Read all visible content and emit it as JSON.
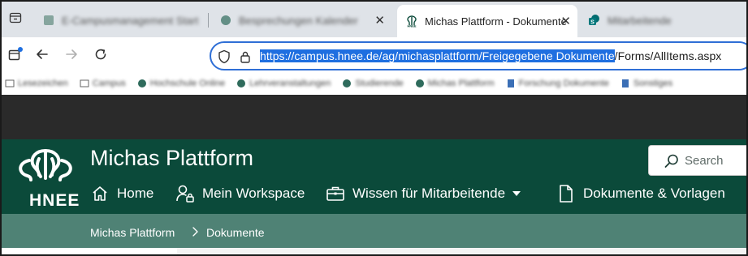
{
  "browser": {
    "tabs": [
      {
        "title": "E-Campusmanagement Startseite",
        "blurred": true,
        "active": false
      },
      {
        "title": "Besprechungen Kalender",
        "blurred": true,
        "active": false,
        "close": "✕"
      },
      {
        "title": "Michas Plattform - Dokumente",
        "blurred": false,
        "active": true,
        "close": "✕"
      },
      {
        "title": "Mitarbeitende",
        "blurred": true,
        "active": false
      }
    ],
    "address_bar": {
      "url_selected": "https://campus.hnee.de/ag/michasplattform/Freigegebene Dokumente",
      "url_rest": "/Forms/AllItems.aspx"
    },
    "bookmarks": [
      "Lesezeichen",
      "Campus",
      "Hochschule Online",
      "Lehrveranstaltungen",
      "Studierende",
      "Michas Plattform",
      "Forschung Dokumente",
      "Sonstiges"
    ]
  },
  "site": {
    "logo_text": "HNEE",
    "title": "Michas Plattform",
    "search_placeholder": "Search",
    "nav": {
      "home": "Home",
      "workspace": "Mein Workspace",
      "wissen": "Wissen für Mitarbeitende",
      "dokumente": "Dokumente & Vorlagen"
    },
    "breadcrumb": {
      "root": "Michas Plattform",
      "current": "Dokumente"
    }
  },
  "colors": {
    "header_bg": "#0b4a3a",
    "breadcrumb_bg": "#4f8275",
    "selection": "#1f6fe0",
    "address_border": "#2f6fd6"
  }
}
